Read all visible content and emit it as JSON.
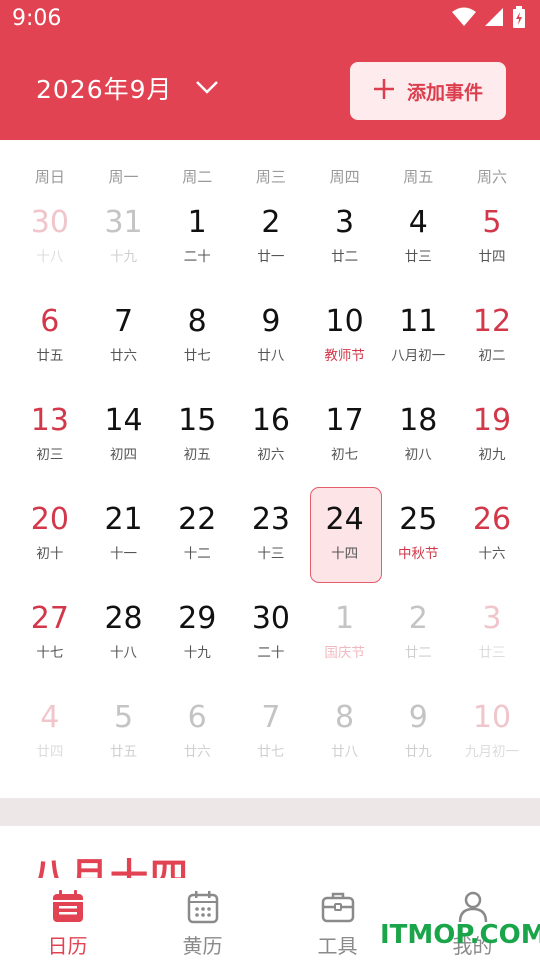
{
  "status_bar": {
    "time": "9:06"
  },
  "header": {
    "month_title": "2026年9月",
    "add_event_label": "添加事件"
  },
  "colors": {
    "accent": "#e24352",
    "weekend": "#d2384a",
    "today_bg": "#fde4e7"
  },
  "weekdays": [
    "周日",
    "周一",
    "周二",
    "周三",
    "周四",
    "周五",
    "周六"
  ],
  "calendar": {
    "weeks": [
      [
        {
          "day": "30",
          "lunar": "十八",
          "other": true,
          "weekend": true
        },
        {
          "day": "31",
          "lunar": "十九",
          "other": true
        },
        {
          "day": "1",
          "lunar": "二十"
        },
        {
          "day": "2",
          "lunar": "廿一"
        },
        {
          "day": "3",
          "lunar": "廿二"
        },
        {
          "day": "4",
          "lunar": "廿三"
        },
        {
          "day": "5",
          "lunar": "廿四",
          "weekend": true
        }
      ],
      [
        {
          "day": "6",
          "lunar": "廿五",
          "weekend": true
        },
        {
          "day": "7",
          "lunar": "廿六"
        },
        {
          "day": "8",
          "lunar": "廿七"
        },
        {
          "day": "9",
          "lunar": "廿八"
        },
        {
          "day": "10",
          "lunar": "教师节",
          "festival": true
        },
        {
          "day": "11",
          "lunar": "八月初一"
        },
        {
          "day": "12",
          "lunar": "初二",
          "weekend": true
        }
      ],
      [
        {
          "day": "13",
          "lunar": "初三",
          "weekend": true
        },
        {
          "day": "14",
          "lunar": "初四"
        },
        {
          "day": "15",
          "lunar": "初五"
        },
        {
          "day": "16",
          "lunar": "初六"
        },
        {
          "day": "17",
          "lunar": "初七"
        },
        {
          "day": "18",
          "lunar": "初八"
        },
        {
          "day": "19",
          "lunar": "初九",
          "weekend": true
        }
      ],
      [
        {
          "day": "20",
          "lunar": "初十",
          "weekend": true
        },
        {
          "day": "21",
          "lunar": "十一"
        },
        {
          "day": "22",
          "lunar": "十二"
        },
        {
          "day": "23",
          "lunar": "十三"
        },
        {
          "day": "24",
          "lunar": "十四",
          "today": true
        },
        {
          "day": "25",
          "lunar": "中秋节",
          "festival": true
        },
        {
          "day": "26",
          "lunar": "十六",
          "weekend": true
        }
      ],
      [
        {
          "day": "27",
          "lunar": "十七",
          "weekend": true
        },
        {
          "day": "28",
          "lunar": "十八"
        },
        {
          "day": "29",
          "lunar": "十九"
        },
        {
          "day": "30",
          "lunar": "二十"
        },
        {
          "day": "1",
          "lunar": "国庆节",
          "other": true,
          "festival": true
        },
        {
          "day": "2",
          "lunar": "廿二",
          "other": true
        },
        {
          "day": "3",
          "lunar": "廿三",
          "other": true,
          "weekend": true
        }
      ],
      [
        {
          "day": "4",
          "lunar": "廿四",
          "other": true,
          "weekend": true
        },
        {
          "day": "5",
          "lunar": "廿五",
          "other": true
        },
        {
          "day": "6",
          "lunar": "廿六",
          "other": true
        },
        {
          "day": "7",
          "lunar": "廿七",
          "other": true
        },
        {
          "day": "8",
          "lunar": "廿八",
          "other": true
        },
        {
          "day": "9",
          "lunar": "廿九",
          "other": true
        },
        {
          "day": "10",
          "lunar": "九月初一",
          "other": true,
          "weekend": true
        }
      ]
    ]
  },
  "peek_section": {
    "title": "八月十四"
  },
  "bottom_nav": {
    "items": [
      {
        "label": "日历",
        "icon": "calendar-icon",
        "active": true
      },
      {
        "label": "黄历",
        "icon": "almanac-icon"
      },
      {
        "label": "工具",
        "icon": "toolbox-icon"
      },
      {
        "label": "我的",
        "icon": "profile-icon"
      }
    ]
  },
  "watermark": "ITMOP.COM"
}
